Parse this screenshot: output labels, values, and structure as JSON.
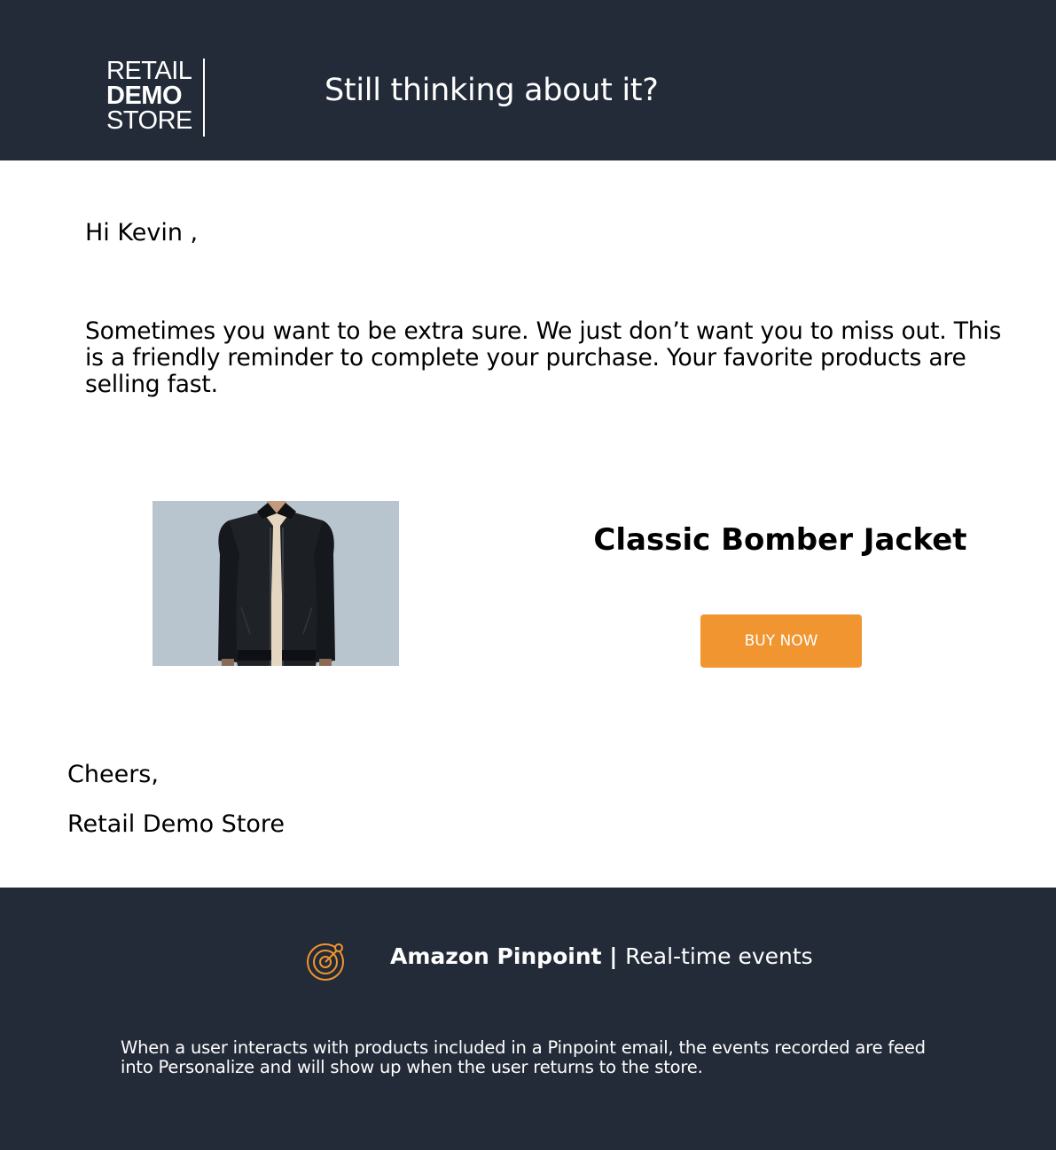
{
  "header": {
    "logo": {
      "line1": "RETAIL",
      "line2": "DEMO",
      "line3": "STORE"
    },
    "title": "Still thinking about it?"
  },
  "body": {
    "greeting": "Hi Kevin ,",
    "intro": "Sometimes you want to be extra sure. We just don’t want you to miss out. This is a friendly reminder to complete your purchase. Your favorite products are selling fast."
  },
  "product": {
    "name": "Classic Bomber Jacket",
    "image": "bomber-jacket-photo",
    "buy_label": "BUY NOW"
  },
  "closing": {
    "signoff": "Cheers,",
    "signature": "Retail Demo Store"
  },
  "footer": {
    "icon": "pinpoint-target-icon",
    "brand": "Amazon Pinpoint",
    "separator": " | ",
    "subtitle": "Real-time events",
    "note": "When a user interacts with products included in a Pinpoint email, the events recorded are feed into Personalize and will show up when the user returns to the store."
  },
  "colors": {
    "header_bg": "#232a38",
    "accent": "#f0952f",
    "text": "#000000",
    "inverse_text": "#ffffff"
  }
}
